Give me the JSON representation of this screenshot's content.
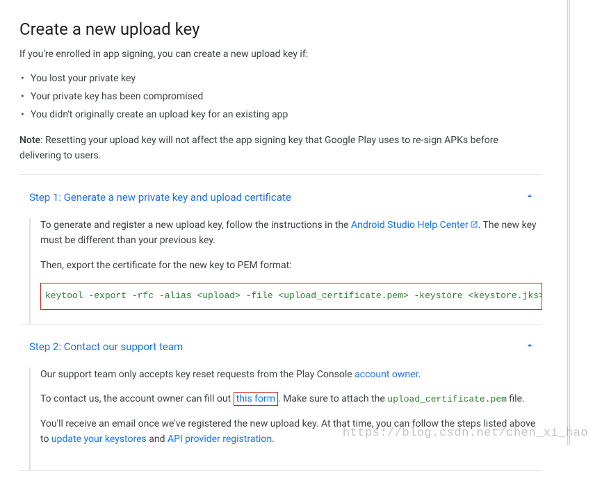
{
  "title": "Create a new upload key",
  "intro": "If you're enrolled in app signing, you can create a new upload key if:",
  "bullets": [
    "You lost your private key",
    "Your private key has been compromised",
    "You didn't originally create an upload key for an existing app"
  ],
  "note_label": "Note",
  "note_text": ": Resetting your upload key will not affect the app signing key that Google Play uses to re-sign APKs before delivering to users.",
  "step1": {
    "title": "Step 1: Generate a new private key and upload certificate",
    "p1a": "To generate and register a new upload key, follow the instructions in the ",
    "help_link": "Android Studio Help Center",
    "p1b": ". The new key must be different than your previous key.",
    "p2": "Then, export the certificate for the new key to PEM format:",
    "code": "keytool -export -rfc -alias <upload> -file <upload_certificate.pem> -keystore <keystore.jks>"
  },
  "step2": {
    "title": "Step 2: Contact our support team",
    "p1a": "Our support team only accepts key reset requests from the Play Console ",
    "owner_link": "account owner",
    "p1b": ".",
    "p2a": "To contact us, the account owner can fill out ",
    "form_link": "this form",
    "p2b": ". Make sure to attach the ",
    "cert_file": "upload_certificate.pem",
    "p2c": " file.",
    "p3a": "You'll receive an email once we've registered the new upload key. At that time, you can follow the steps listed above to ",
    "keystore_link": "update your keystores",
    "p3b": " and ",
    "api_link": "API provider registration",
    "p3c": "."
  },
  "watermark": "https://blog.csdn.net/chen_xi_hao"
}
